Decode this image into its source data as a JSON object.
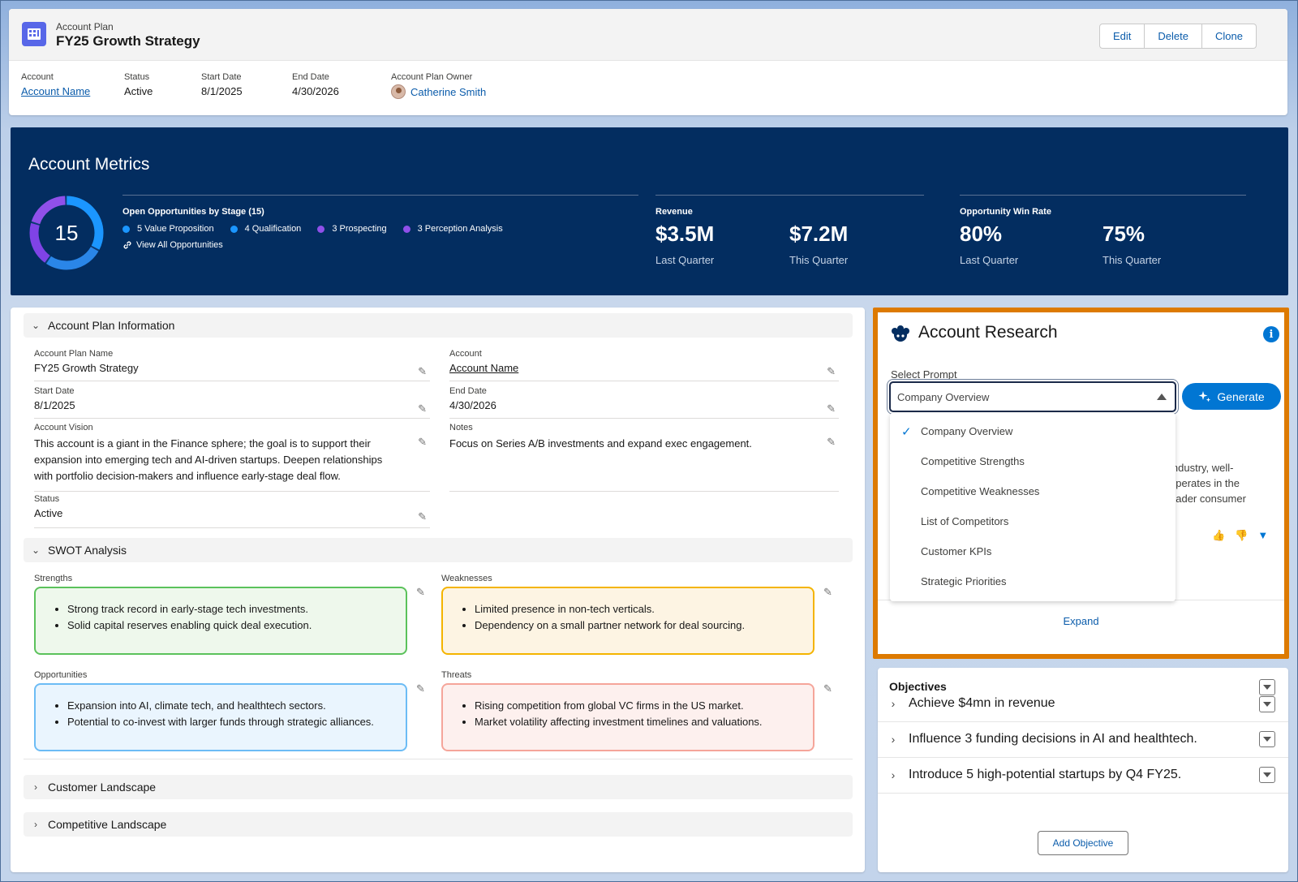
{
  "header": {
    "record_type": "Account Plan",
    "title": "FY25 Growth Strategy",
    "buttons": {
      "edit": "Edit",
      "delete": "Delete",
      "clone": "Clone"
    },
    "fields": {
      "account_label": "Account",
      "account_value": "Account Name",
      "status_label": "Status",
      "status_value": "Active",
      "start_label": "Start Date",
      "start_value": "8/1/2025",
      "end_label": "End Date",
      "end_value": "4/30/2026",
      "owner_label": "Account Plan Owner",
      "owner_value": "Catherine Smith"
    }
  },
  "metrics": {
    "title": "Account Metrics",
    "open_count": "15",
    "opps_title": "Open Opportunities by Stage (15)",
    "stages": [
      {
        "label": "5 Value Proposition",
        "count": 5,
        "color": "#1b96ff"
      },
      {
        "label": "4 Qualification",
        "count": 4,
        "color": "#1b96ff"
      },
      {
        "label": "3 Prospecting",
        "count": 3,
        "color": "#9050e9"
      },
      {
        "label": "3 Perception Analysis",
        "count": 3,
        "color": "#9050e9"
      }
    ],
    "view_all": "View All Opportunities",
    "revenue_title": "Revenue",
    "revenue_last": "$3.5M",
    "revenue_last_label": "Last Quarter",
    "revenue_this": "$7.2M",
    "revenue_this_label": "This Quarter",
    "win_title": "Opportunity Win Rate",
    "win_last": "80%",
    "win_last_label": "Last Quarter",
    "win_this": "75%",
    "win_this_label": "This Quarter"
  },
  "plan_info": {
    "section_title": "Account Plan Information",
    "name_label": "Account Plan Name",
    "name_value": "FY25 Growth Strategy",
    "account_label": "Account",
    "account_value": "Account Name",
    "start_label": "Start Date",
    "start_value": "8/1/2025",
    "end_label": "End Date",
    "end_value": "4/30/2026",
    "vision_label": "Account Vision",
    "vision_value": "This account is a giant in the Finance sphere; the goal is to support their expansion into emerging tech and AI-driven startups. Deepen relationships with portfolio decision-makers and influence early-stage deal flow.",
    "notes_label": "Notes",
    "notes_value": "Focus on Series A/B investments and expand exec engagement.",
    "status_label": "Status",
    "status_value": "Active"
  },
  "swot": {
    "section_title": "SWOT Analysis",
    "strengths_label": "Strengths",
    "strengths": [
      "Strong track record in early-stage tech investments.",
      "Solid capital reserves enabling quick deal execution."
    ],
    "weaknesses_label": "Weaknesses",
    "weaknesses": [
      "Limited presence in non-tech verticals.",
      "Dependency on a small partner network for deal sourcing."
    ],
    "opportunities_label": "Opportunities",
    "opportunities": [
      "Expansion into AI, climate tech, and healthtech sectors.",
      "Potential to co-invest with larger funds through strategic alliances."
    ],
    "threats_label": "Threats",
    "threats": [
      "Rising competition from global VC firms in the US market.",
      "Market volatility affecting investment timelines and valuations."
    ],
    "colors": {
      "strengths": "#5bc25b",
      "weaknesses": "#f4b400",
      "opportunities": "#6cbcf5",
      "threats": "#f5a59a"
    }
  },
  "collapsed_sections": {
    "customer": "Customer Landscape",
    "competitive": "Competitive Landscape"
  },
  "research": {
    "title": "Account Research",
    "select_label": "Select Prompt",
    "selected": "Company Overview",
    "generate": "Generate",
    "options": [
      "Company Overview",
      "Competitive Strengths",
      "Competitive Weaknesses",
      "List of Competitors",
      "Customer KPIs",
      "Strategic Priorities"
    ],
    "peek_lines": [
      "industry, well-",
      "operates in the",
      "oader consumer"
    ],
    "expand": "Expand"
  },
  "objectives": {
    "title": "Objectives",
    "items": [
      "Achieve $4mn in revenue",
      "Influence 3 funding decisions in AI and healthtech.",
      "Introduce 5 high-potential startups by Q4 FY25."
    ],
    "add_button": "Add Objective"
  }
}
